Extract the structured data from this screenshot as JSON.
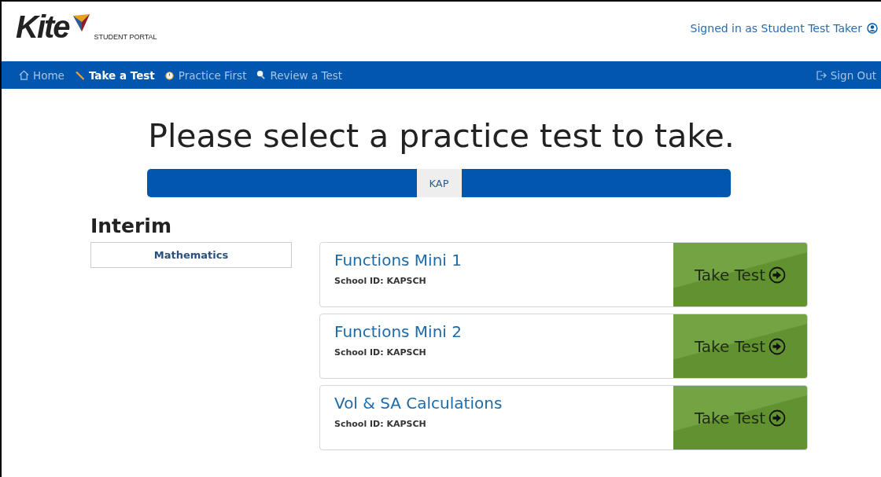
{
  "header": {
    "logo_text": "Kite",
    "logo_subtitle": "STUDENT PORTAL",
    "signed_in": "Signed in as Student Test Taker"
  },
  "nav": {
    "items": [
      {
        "label": "Home",
        "selected": false
      },
      {
        "label": "Take a Test",
        "selected": true
      },
      {
        "label": "Practice First",
        "selected": false
      },
      {
        "label": "Review a Test",
        "selected": false
      }
    ],
    "sign_out": "Sign Out"
  },
  "heading": "Please select a practice test to take.",
  "tabs": [
    {
      "label": "KAP",
      "selected": true
    }
  ],
  "section": {
    "title": "Interim",
    "subjects": [
      {
        "label": "Mathematics",
        "selected": true
      }
    ],
    "tests": [
      {
        "name": "Functions Mini 1",
        "school_id": "School ID: KAPSCH",
        "action": "Take Test"
      },
      {
        "name": "Functions Mini 2",
        "school_id": "School ID: KAPSCH",
        "action": "Take Test"
      },
      {
        "name": "Vol & SA Calculations",
        "school_id": "School ID: KAPSCH",
        "action": "Take Test"
      }
    ]
  }
}
